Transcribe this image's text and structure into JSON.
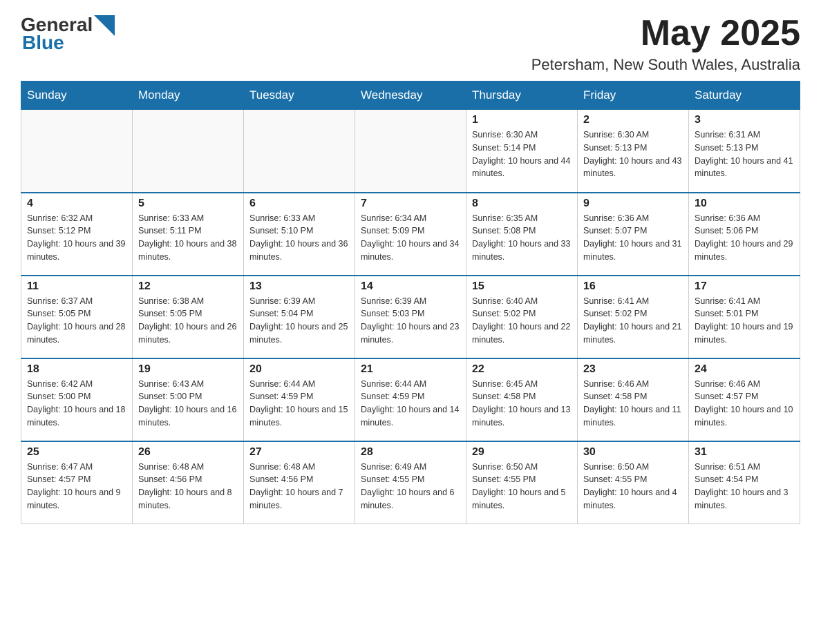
{
  "header": {
    "logo_general": "General",
    "logo_blue": "Blue",
    "month_title": "May 2025",
    "location": "Petersham, New South Wales, Australia"
  },
  "days_of_week": [
    "Sunday",
    "Monday",
    "Tuesday",
    "Wednesday",
    "Thursday",
    "Friday",
    "Saturday"
  ],
  "weeks": [
    [
      {
        "day": "",
        "info": ""
      },
      {
        "day": "",
        "info": ""
      },
      {
        "day": "",
        "info": ""
      },
      {
        "day": "",
        "info": ""
      },
      {
        "day": "1",
        "info": "Sunrise: 6:30 AM\nSunset: 5:14 PM\nDaylight: 10 hours and 44 minutes."
      },
      {
        "day": "2",
        "info": "Sunrise: 6:30 AM\nSunset: 5:13 PM\nDaylight: 10 hours and 43 minutes."
      },
      {
        "day": "3",
        "info": "Sunrise: 6:31 AM\nSunset: 5:13 PM\nDaylight: 10 hours and 41 minutes."
      }
    ],
    [
      {
        "day": "4",
        "info": "Sunrise: 6:32 AM\nSunset: 5:12 PM\nDaylight: 10 hours and 39 minutes."
      },
      {
        "day": "5",
        "info": "Sunrise: 6:33 AM\nSunset: 5:11 PM\nDaylight: 10 hours and 38 minutes."
      },
      {
        "day": "6",
        "info": "Sunrise: 6:33 AM\nSunset: 5:10 PM\nDaylight: 10 hours and 36 minutes."
      },
      {
        "day": "7",
        "info": "Sunrise: 6:34 AM\nSunset: 5:09 PM\nDaylight: 10 hours and 34 minutes."
      },
      {
        "day": "8",
        "info": "Sunrise: 6:35 AM\nSunset: 5:08 PM\nDaylight: 10 hours and 33 minutes."
      },
      {
        "day": "9",
        "info": "Sunrise: 6:36 AM\nSunset: 5:07 PM\nDaylight: 10 hours and 31 minutes."
      },
      {
        "day": "10",
        "info": "Sunrise: 6:36 AM\nSunset: 5:06 PM\nDaylight: 10 hours and 29 minutes."
      }
    ],
    [
      {
        "day": "11",
        "info": "Sunrise: 6:37 AM\nSunset: 5:05 PM\nDaylight: 10 hours and 28 minutes."
      },
      {
        "day": "12",
        "info": "Sunrise: 6:38 AM\nSunset: 5:05 PM\nDaylight: 10 hours and 26 minutes."
      },
      {
        "day": "13",
        "info": "Sunrise: 6:39 AM\nSunset: 5:04 PM\nDaylight: 10 hours and 25 minutes."
      },
      {
        "day": "14",
        "info": "Sunrise: 6:39 AM\nSunset: 5:03 PM\nDaylight: 10 hours and 23 minutes."
      },
      {
        "day": "15",
        "info": "Sunrise: 6:40 AM\nSunset: 5:02 PM\nDaylight: 10 hours and 22 minutes."
      },
      {
        "day": "16",
        "info": "Sunrise: 6:41 AM\nSunset: 5:02 PM\nDaylight: 10 hours and 21 minutes."
      },
      {
        "day": "17",
        "info": "Sunrise: 6:41 AM\nSunset: 5:01 PM\nDaylight: 10 hours and 19 minutes."
      }
    ],
    [
      {
        "day": "18",
        "info": "Sunrise: 6:42 AM\nSunset: 5:00 PM\nDaylight: 10 hours and 18 minutes."
      },
      {
        "day": "19",
        "info": "Sunrise: 6:43 AM\nSunset: 5:00 PM\nDaylight: 10 hours and 16 minutes."
      },
      {
        "day": "20",
        "info": "Sunrise: 6:44 AM\nSunset: 4:59 PM\nDaylight: 10 hours and 15 minutes."
      },
      {
        "day": "21",
        "info": "Sunrise: 6:44 AM\nSunset: 4:59 PM\nDaylight: 10 hours and 14 minutes."
      },
      {
        "day": "22",
        "info": "Sunrise: 6:45 AM\nSunset: 4:58 PM\nDaylight: 10 hours and 13 minutes."
      },
      {
        "day": "23",
        "info": "Sunrise: 6:46 AM\nSunset: 4:58 PM\nDaylight: 10 hours and 11 minutes."
      },
      {
        "day": "24",
        "info": "Sunrise: 6:46 AM\nSunset: 4:57 PM\nDaylight: 10 hours and 10 minutes."
      }
    ],
    [
      {
        "day": "25",
        "info": "Sunrise: 6:47 AM\nSunset: 4:57 PM\nDaylight: 10 hours and 9 minutes."
      },
      {
        "day": "26",
        "info": "Sunrise: 6:48 AM\nSunset: 4:56 PM\nDaylight: 10 hours and 8 minutes."
      },
      {
        "day": "27",
        "info": "Sunrise: 6:48 AM\nSunset: 4:56 PM\nDaylight: 10 hours and 7 minutes."
      },
      {
        "day": "28",
        "info": "Sunrise: 6:49 AM\nSunset: 4:55 PM\nDaylight: 10 hours and 6 minutes."
      },
      {
        "day": "29",
        "info": "Sunrise: 6:50 AM\nSunset: 4:55 PM\nDaylight: 10 hours and 5 minutes."
      },
      {
        "day": "30",
        "info": "Sunrise: 6:50 AM\nSunset: 4:55 PM\nDaylight: 10 hours and 4 minutes."
      },
      {
        "day": "31",
        "info": "Sunrise: 6:51 AM\nSunset: 4:54 PM\nDaylight: 10 hours and 3 minutes."
      }
    ]
  ]
}
